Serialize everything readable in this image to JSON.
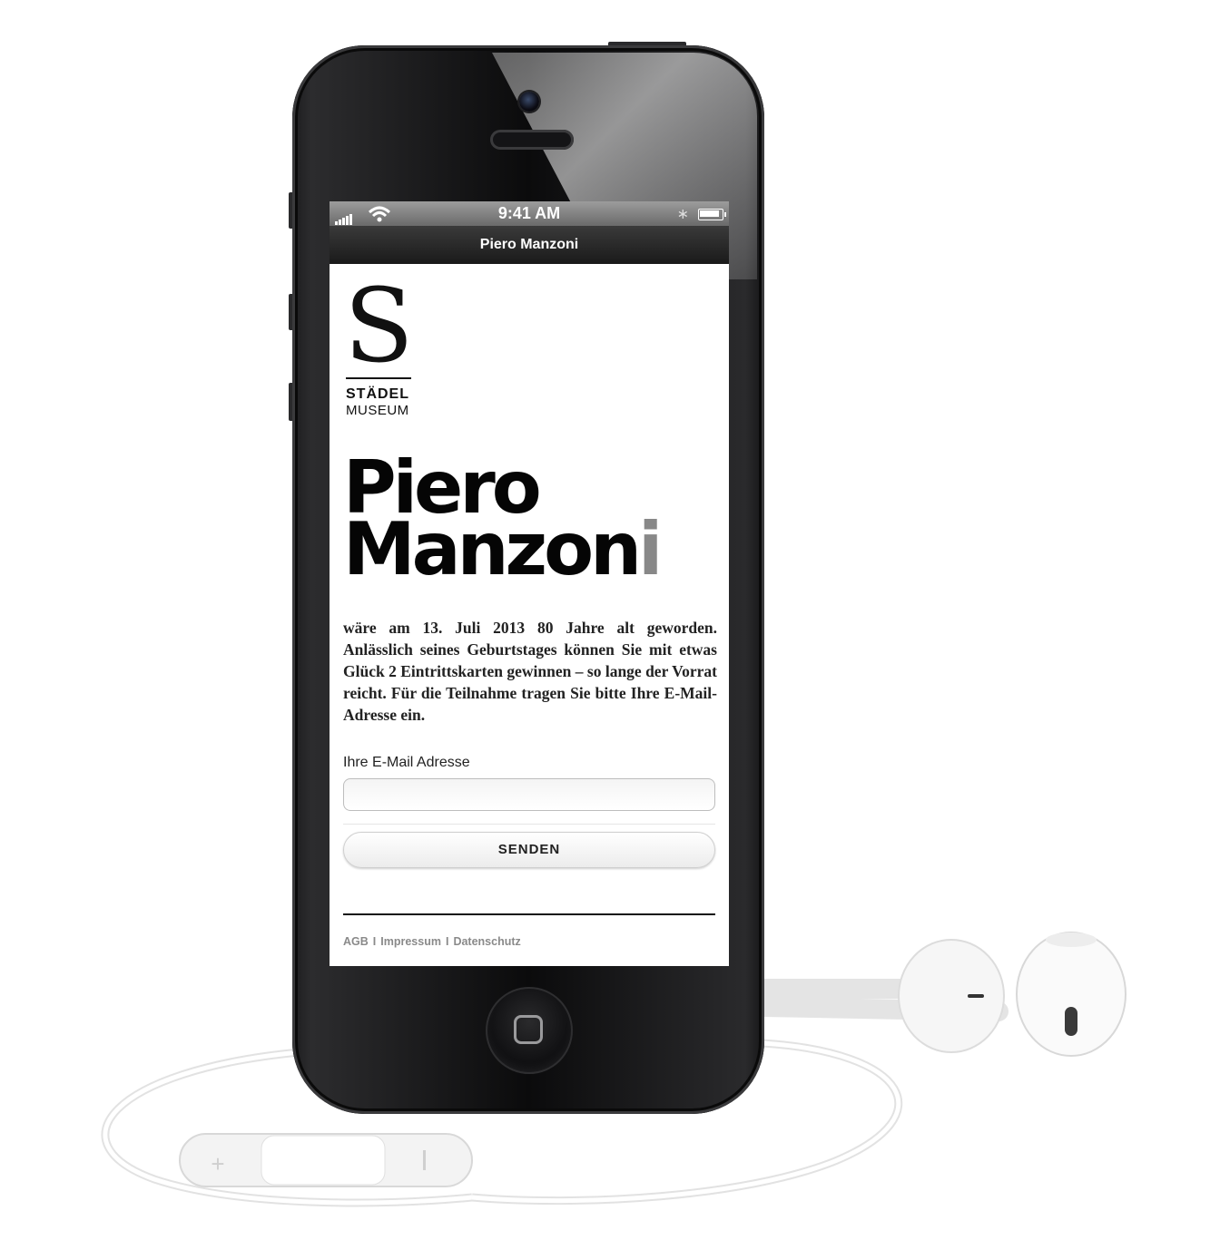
{
  "statusbar": {
    "time": "9:41 AM"
  },
  "navbar": {
    "title": "Piero Manzoni"
  },
  "logo": {
    "letter": "S",
    "line1": "STÄDEL",
    "line2": "MUSEUM"
  },
  "headline": {
    "line1": "Piero",
    "line2_main": "Manzon",
    "line2_faded": "i"
  },
  "body": {
    "text": "wäre am 13. Juli 2013 80 Jahre alt geworden. Anlässlich seines Geburtstages können Sie mit etwas Glück 2 Eintrittskarten gewinnen – so lange der Vorrat reicht. Für die Teilnahme tragen Sie bitte Ihre E-Mail-Adresse ein."
  },
  "form": {
    "email_label": "Ihre E-Mail Adresse",
    "email_value": "",
    "submit_label": "SENDEN"
  },
  "footer": {
    "links": [
      "AGB",
      "Impressum",
      "Datenschutz"
    ],
    "separator": "I"
  },
  "icons": [
    "signal-icon",
    "wifi-icon",
    "bluetooth-icon",
    "battery-icon",
    "home-button-icon"
  ]
}
